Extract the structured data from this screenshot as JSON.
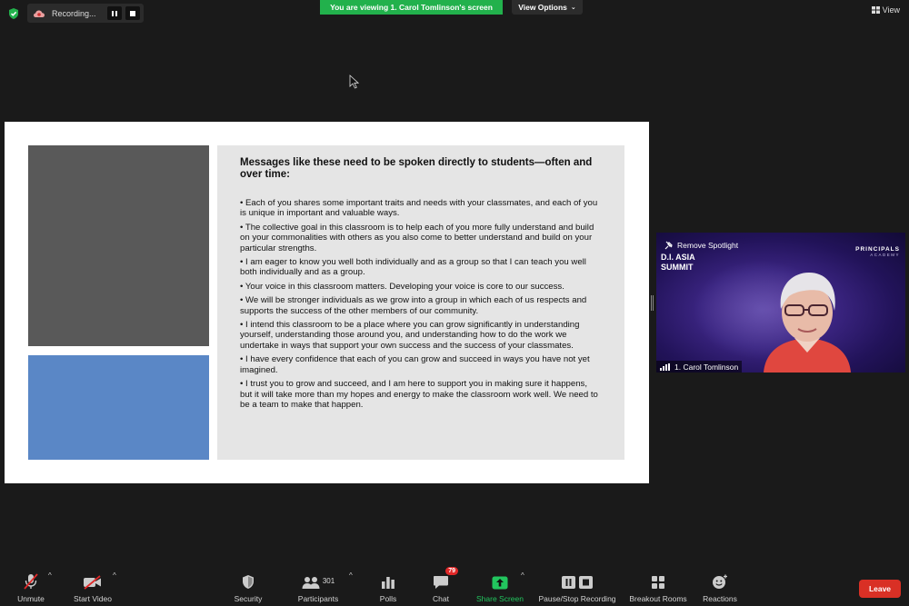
{
  "top_bar": {
    "recording_label": "Recording...",
    "viewing_banner": "You are viewing 1. Carol Tomlinson's screen",
    "view_options_label": "View Options",
    "view_label": "View"
  },
  "slide": {
    "heading": "Messages like these need to be spoken directly to students—often and over time:",
    "bullets": [
      "• Each of you shares some important traits and needs with your classmates, and each of you is unique in important and valuable ways.",
      "• The collective goal in this classroom is to help each of you more fully understand and build on your commonalities with others as you also come to better understand and build on your particular strengths.",
      "• I am eager to know you well both individually and as a group so that I can teach you well both individually and as a group.",
      "• Your voice in this classroom matters. Developing your voice is core to our success.",
      "• We will be stronger individuals as we grow into a group in which each of us respects and supports the success of the other members of our community.",
      "• I intend this classroom to be a place where you can grow significantly in understanding yourself, understanding those around you, and understanding how to do the work we undertake in ways that support your own success and the success of your classmates.",
      "• I have every confidence that each of you can grow and succeed in ways you have not yet imagined.",
      "• I trust you to grow and succeed, and I am here to support you in making sure it happens, but it will take more than my hopes and energy to make the classroom work well. We need to be a team to make that happen."
    ]
  },
  "video": {
    "remove_spotlight_label": "Remove Spotlight",
    "event_title_line1": "D.I. ASIA",
    "event_title_line2": "SUMMIT",
    "org_name": "PRINCIPALS",
    "org_sub": "ACADEMY",
    "participant_name": "1. Carol Tomlinson"
  },
  "toolbar": {
    "unmute": "Unmute",
    "start_video": "Start Video",
    "security": "Security",
    "participants": "Participants",
    "participant_count": "301",
    "polls": "Polls",
    "chat": "Chat",
    "chat_badge": "79",
    "share_screen": "Share Screen",
    "pause_stop_recording": "Pause/Stop Recording",
    "breakout_rooms": "Breakout Rooms",
    "reactions": "Reactions",
    "leave": "Leave"
  },
  "colors": {
    "background": "#1a1a1a",
    "banner_green": "#22b14c",
    "leave_red": "#d93025",
    "slide_gray_block": "#595959",
    "slide_blue_block": "#5a87c6"
  }
}
